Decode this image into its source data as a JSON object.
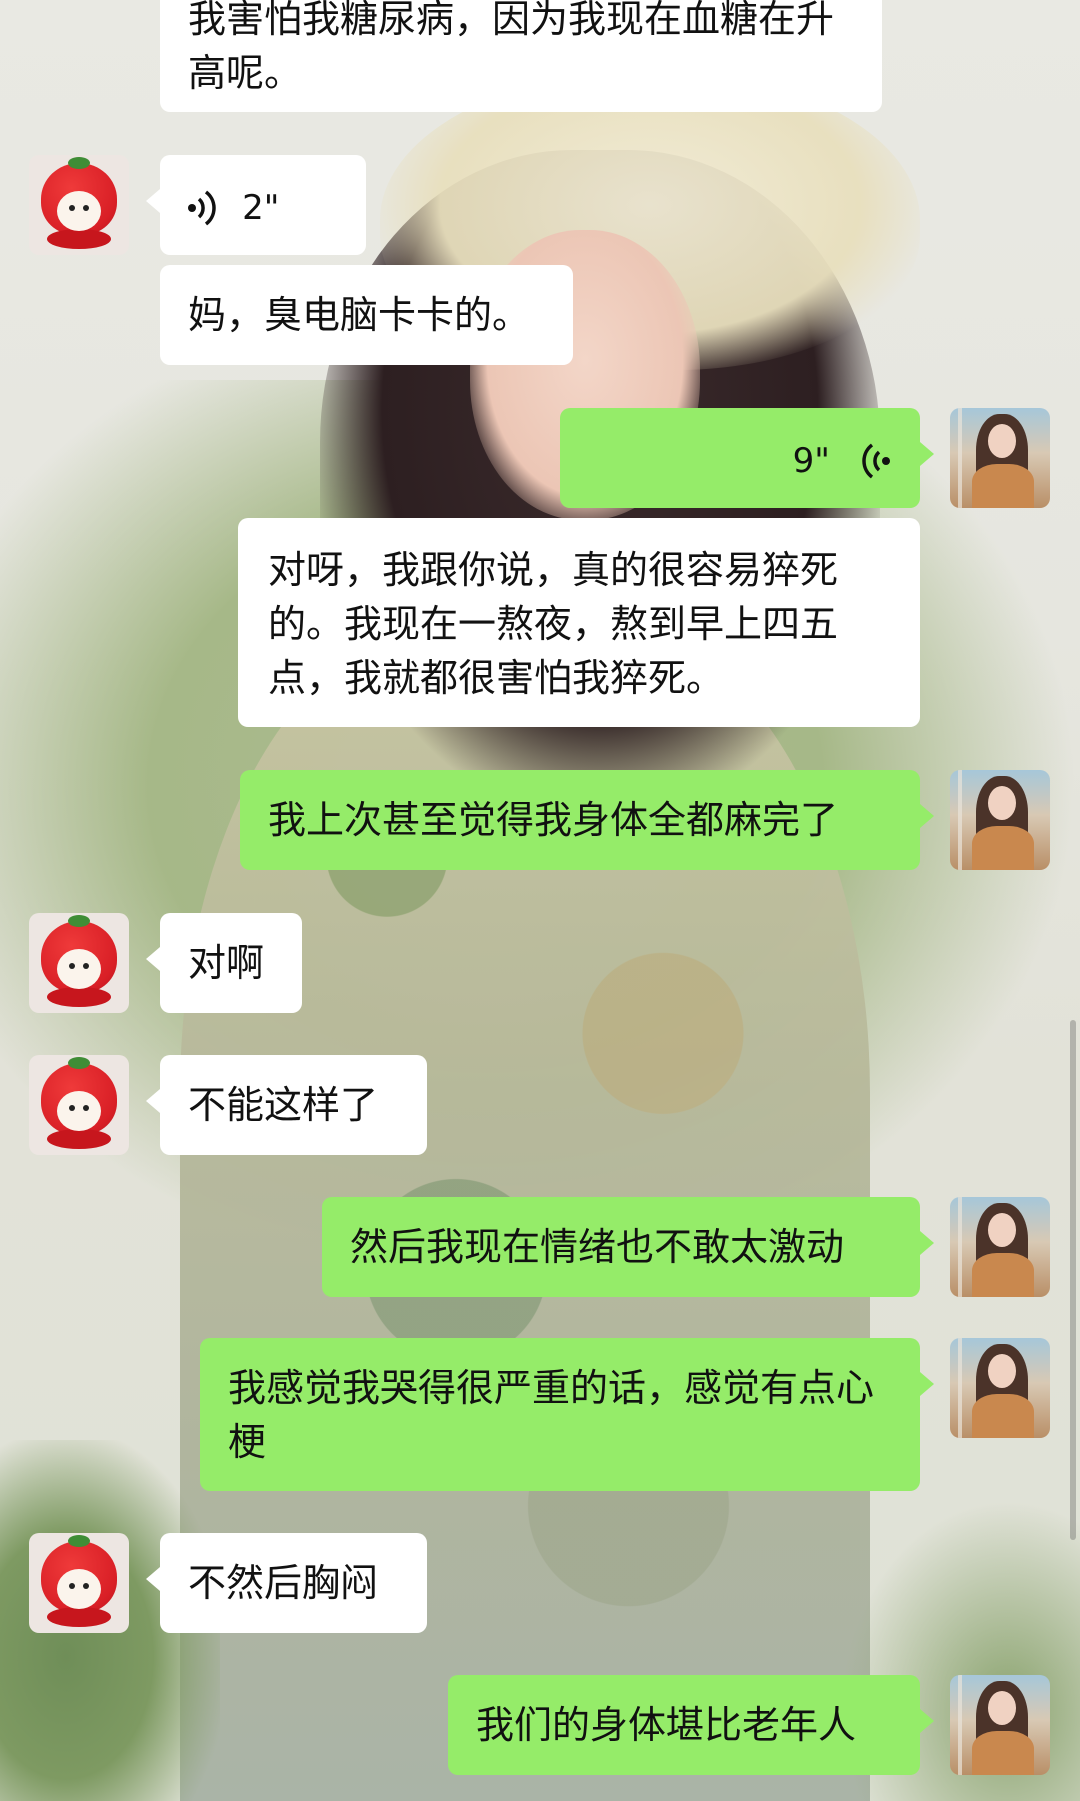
{
  "messages": [
    {
      "side": "left",
      "type": "text",
      "text": "我害怕我糖尿病，因为我现在血糖在升高呢。",
      "avatar": "strawberry-avatar",
      "partial": true
    },
    {
      "side": "left",
      "type": "voice",
      "duration": "2\"",
      "avatar": "strawberry-avatar"
    },
    {
      "side": "left",
      "type": "text",
      "text": "妈，臭电脑卡卡的。"
    },
    {
      "side": "right",
      "type": "voice",
      "duration": "9\"",
      "avatar": "girl-avatar"
    },
    {
      "side": "right",
      "type": "text",
      "text": "对呀，我跟你说，真的很容易猝死的。我现在一熬夜，熬到早上四五点，我就都很害怕我猝死。",
      "bubble_color": "white"
    },
    {
      "side": "right",
      "type": "text",
      "text": "我上次甚至觉得我身体全都麻完了",
      "avatar": "girl-avatar"
    },
    {
      "side": "left",
      "type": "text",
      "text": "对啊",
      "avatar": "strawberry-avatar"
    },
    {
      "side": "left",
      "type": "text",
      "text": "不能这样了",
      "avatar": "strawberry-avatar"
    },
    {
      "side": "right",
      "type": "text",
      "text": "然后我现在情绪也不敢太激动",
      "avatar": "girl-avatar"
    },
    {
      "side": "right",
      "type": "text",
      "text": "我感觉我哭得很严重的话，感觉有点心梗",
      "avatar": "girl-avatar"
    },
    {
      "side": "left",
      "type": "text",
      "text": "不然后胸闷",
      "avatar": "strawberry-avatar"
    },
    {
      "side": "right",
      "type": "text",
      "text": "我们的身体堪比老年人",
      "avatar": "girl-avatar"
    }
  ],
  "colors": {
    "sent_bubble": "#95ec69",
    "received_bubble": "#ffffff"
  }
}
